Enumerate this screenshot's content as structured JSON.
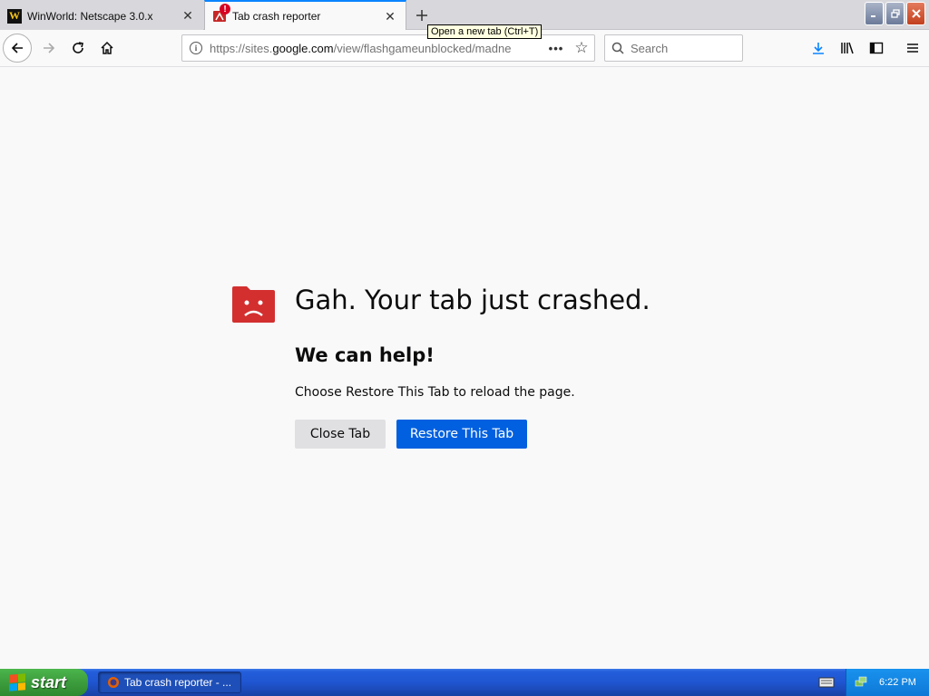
{
  "tabs": [
    {
      "title": "WinWorld: Netscape 3.0.x",
      "favicon": "winworld-icon"
    },
    {
      "title": "Tab crash reporter",
      "favicon": "crash-reporter-icon",
      "active": true
    }
  ],
  "tooltip": {
    "text": "Open a new tab (Ctrl+T)"
  },
  "window_controls": {
    "minimize": "minimize-icon",
    "restore": "restore-icon",
    "close": "close-icon"
  },
  "navbar": {
    "url_prefix": "https://sites.",
    "url_domain": "google.com",
    "url_path": "/view/flashgameunblocked/madne",
    "search_placeholder": "Search"
  },
  "content": {
    "title": "Gah. Your tab just crashed.",
    "subtitle": "We can help!",
    "description": "Choose Restore This Tab to reload the page.",
    "close_tab_label": "Close Tab",
    "restore_tab_label": "Restore This Tab"
  },
  "taskbar": {
    "start_label": "start",
    "task_label": "Tab crash reporter - ...",
    "clock": "6:22 PM"
  },
  "colors": {
    "accent": "#0060df",
    "crash_icon": "#d32f2f",
    "taskbar": "#245edb",
    "start": "#3c9c3c"
  }
}
